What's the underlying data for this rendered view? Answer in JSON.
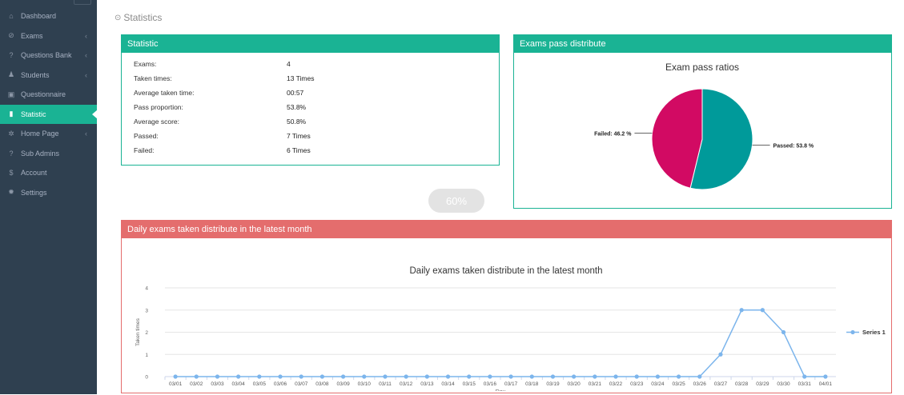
{
  "sidebar": {
    "items": [
      {
        "label": "Dashboard",
        "icon": "home-icon",
        "arrow": false,
        "active": false
      },
      {
        "label": "Exams",
        "icon": "check-circle-icon",
        "arrow": true,
        "active": false
      },
      {
        "label": "Questions Bank",
        "icon": "question-circle-icon",
        "arrow": true,
        "active": false
      },
      {
        "label": "Students",
        "icon": "users-icon",
        "arrow": true,
        "active": false
      },
      {
        "label": "Questionnaire",
        "icon": "checkbox-icon",
        "arrow": false,
        "active": false
      },
      {
        "label": "Statistic",
        "icon": "bar-chart-icon",
        "arrow": false,
        "active": true
      },
      {
        "label": "Home Page",
        "icon": "cog-icon",
        "arrow": true,
        "active": false
      },
      {
        "label": "Sub Admins",
        "icon": "question-circle-icon",
        "arrow": false,
        "active": false
      },
      {
        "label": "Account",
        "icon": "dollar-icon",
        "arrow": false,
        "active": false
      },
      {
        "label": "Settings",
        "icon": "gear-icon",
        "arrow": false,
        "active": false
      }
    ]
  },
  "page": {
    "title": "Statistics"
  },
  "statistic_panel": {
    "title": "Statistic",
    "rows": [
      {
        "label": "Exams:",
        "value": "4"
      },
      {
        "label": "Taken times:",
        "value": "13 Times"
      },
      {
        "label": "Average taken time:",
        "value": "00:57"
      },
      {
        "label": "Pass proportion:",
        "value": "53.8%"
      },
      {
        "label": "Average score:",
        "value": "50.8%"
      },
      {
        "label": "Passed:",
        "value": "7 Times"
      },
      {
        "label": "Failed:",
        "value": "6 Times"
      }
    ]
  },
  "progress": {
    "label": "60%"
  },
  "pie_panel": {
    "title": "Exams pass distribute"
  },
  "line_panel": {
    "title": "Daily exams taken distribute in the latest month"
  },
  "chart_data": [
    {
      "type": "pie",
      "title": "Exam pass ratios",
      "slices": [
        {
          "label": "Passed",
          "value": 53.8,
          "display": "Passed: 53.8 %",
          "color": "#009a9a"
        },
        {
          "label": "Failed",
          "value": 46.2,
          "display": "Failed: 46.2 %",
          "color": "#d20a63"
        }
      ]
    },
    {
      "type": "line",
      "title": "Daily exams taken distribute in the latest month",
      "xlabel": "Day",
      "ylabel": "Taken times",
      "ylim": [
        0,
        4
      ],
      "yticks": [
        0,
        1,
        2,
        3,
        4
      ],
      "grid": true,
      "legend": "right",
      "categories": [
        "03/01",
        "03/02",
        "03/03",
        "03/04",
        "03/05",
        "03/06",
        "03/07",
        "03/08",
        "03/09",
        "03/10",
        "03/11",
        "03/12",
        "03/13",
        "03/14",
        "03/15",
        "03/16",
        "03/17",
        "03/18",
        "03/19",
        "03/20",
        "03/21",
        "03/22",
        "03/23",
        "03/24",
        "03/25",
        "03/26",
        "03/27",
        "03/28",
        "03/29",
        "03/30",
        "03/31",
        "04/01"
      ],
      "series": [
        {
          "name": "Series 1",
          "color": "#7cb5ec",
          "values": [
            0,
            0,
            0,
            0,
            0,
            0,
            0,
            0,
            0,
            0,
            0,
            0,
            0,
            0,
            0,
            0,
            0,
            0,
            0,
            0,
            0,
            0,
            0,
            0,
            0,
            0,
            1,
            3,
            3,
            2,
            0,
            0
          ]
        }
      ]
    }
  ]
}
